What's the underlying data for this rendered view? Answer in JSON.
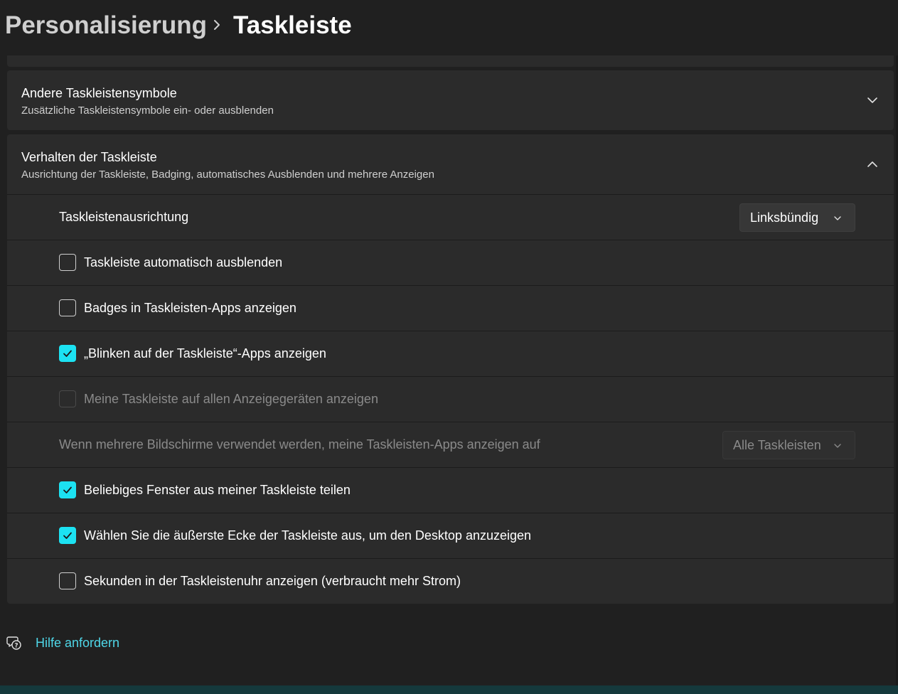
{
  "breadcrumb": {
    "parent": "Personalisierung",
    "current": "Taskleiste"
  },
  "sections": {
    "other_icons": {
      "title": "Andere Taskleistensymbole",
      "subtitle": "Zusätzliche Taskleistensymbole ein- oder ausblenden",
      "expanded": false
    },
    "behavior": {
      "title": "Verhalten der Taskleiste",
      "subtitle": "Ausrichtung der Taskleiste, Badging, automatisches Ausblenden und mehrere Anzeigen",
      "expanded": true
    }
  },
  "settings": {
    "alignment": {
      "label": "Taskleistenausrichtung",
      "value": "Linksbündig"
    },
    "autohide": {
      "label": "Taskleiste automatisch ausblenden",
      "checked": false
    },
    "badges": {
      "label": "Badges in Taskleisten-Apps anzeigen",
      "checked": false
    },
    "flashing": {
      "label": "„Blinken auf der Taskleiste“-Apps anzeigen",
      "checked": true
    },
    "all_displays": {
      "label": "Meine Taskleiste auf allen Anzeigegeräten anzeigen",
      "checked": false,
      "disabled": true
    },
    "multi_display": {
      "label": "Wenn mehrere Bildschirme verwendet werden, meine Taskleisten-Apps anzeigen auf",
      "value": "Alle Taskleisten",
      "disabled": true
    },
    "share_window": {
      "label": "Beliebiges Fenster aus meiner Taskleiste teilen",
      "checked": true
    },
    "corner_desktop": {
      "label": "Wählen Sie die äußerste Ecke der Taskleiste aus, um den Desktop anzuzeigen",
      "checked": true
    },
    "seconds_clock": {
      "label": "Sekunden in der Taskleistenuhr anzeigen (verbraucht mehr Strom)",
      "checked": false
    }
  },
  "help": {
    "label": "Hilfe anfordern"
  },
  "colors": {
    "accent": "#1ce2f2",
    "link": "#4fd7e8",
    "background": "#202020",
    "card": "#2b2b2b"
  }
}
